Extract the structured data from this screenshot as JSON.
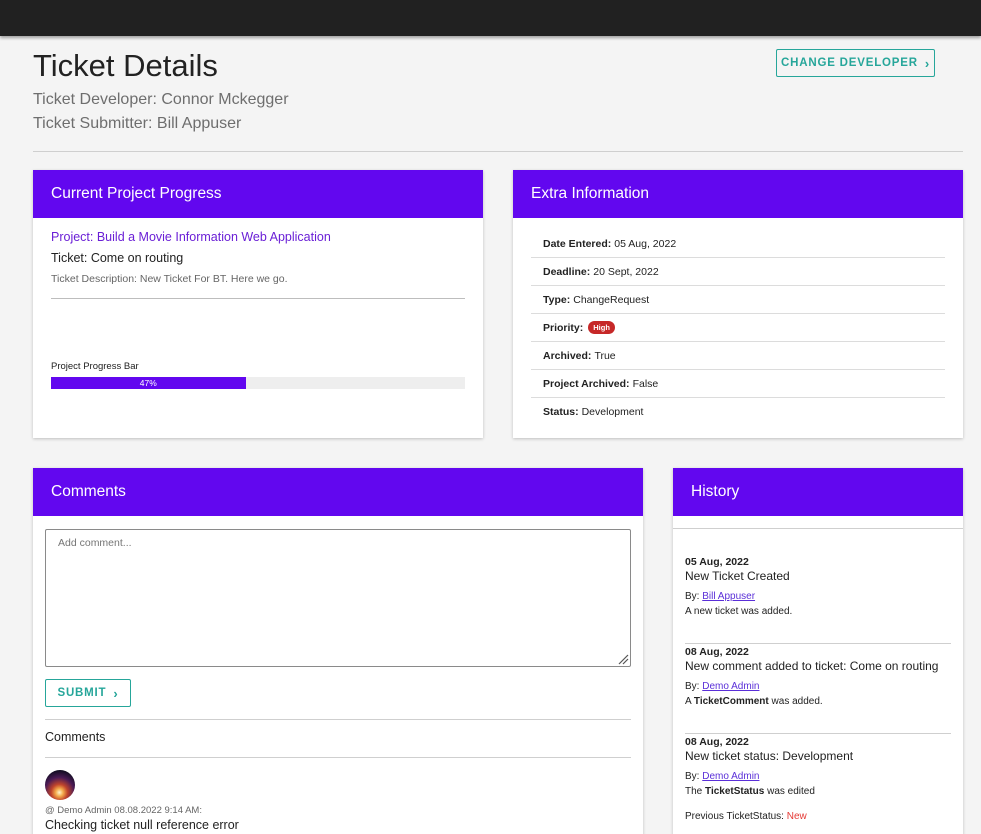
{
  "header": {
    "title": "Ticket Details",
    "developer_label": "Ticket Developer:",
    "developer_name": "Connor Mckegger",
    "submitter_label": "Ticket Submitter:",
    "submitter_name": "Bill Appuser",
    "change_developer_label": "CHANGE DEVELOPER"
  },
  "progress_card": {
    "title": "Current Project Progress",
    "project_link": "Project: Build a Movie Information Web Application",
    "ticket_line": "Ticket: Come on routing",
    "description": "Ticket Description: New Ticket For BT. Here we go.",
    "progress_label": "Project Progress Bar",
    "progress_percent": 47,
    "progress_text": "47%"
  },
  "extra_info": {
    "title": "Extra Information",
    "date_entered_key": "Date Entered:",
    "date_entered_val": "05 Aug, 2022",
    "deadline_key": "Deadline:",
    "deadline_val": "20 Sept, 2022",
    "type_key": "Type:",
    "type_val": "ChangeRequest",
    "priority_key": "Priority:",
    "priority_val": "High",
    "priority_color": "#c62828",
    "archived_key": "Archived:",
    "archived_val": "True",
    "project_archived_key": "Project Archived:",
    "project_archived_val": "False",
    "status_key": "Status:",
    "status_val": "Development"
  },
  "comments": {
    "title": "Comments",
    "placeholder": "Add comment...",
    "submit_label": "SUBMIT",
    "list_heading": "Comments",
    "items": [
      {
        "meta": "@ Demo Admin 08.08.2022 9:14 AM:",
        "text": "Checking ticket null reference error"
      }
    ]
  },
  "history": {
    "title": "History",
    "by_label": "By:",
    "items": [
      {
        "date": "05 Aug, 2022",
        "title": "New Ticket Created",
        "user": "Bill Appuser",
        "desc": "A new ticket was added."
      },
      {
        "date": "08 Aug, 2022",
        "title": "New comment added to ticket: Come on routing",
        "user": "Demo Admin",
        "desc_prefix": "A",
        "desc_bold": "TicketComment",
        "desc_suffix": "was added."
      },
      {
        "date": "08 Aug, 2022",
        "title": "New ticket status: Development",
        "user": "Demo Admin",
        "desc_prefix": "The",
        "desc_bold": "TicketStatus",
        "desc_suffix": "was edited",
        "prev_label": "Previous TicketStatus:",
        "prev_value": "New"
      }
    ]
  },
  "colors": {
    "accent": "#6207ef",
    "teal": "#26a69a",
    "topbar": "#212121",
    "link": "#6a1fd6",
    "danger": "#e53935"
  }
}
